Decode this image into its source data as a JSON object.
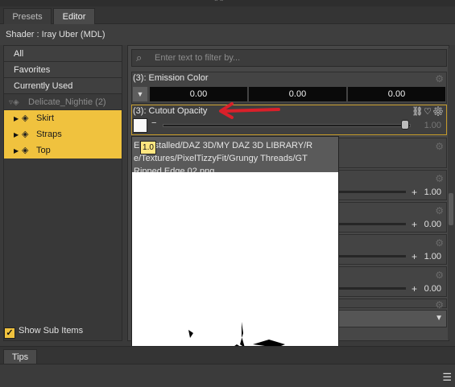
{
  "tabs": [
    {
      "label": "Presets"
    },
    {
      "label": "Editor"
    }
  ],
  "shader_label": "Shader :  Iray Uber (MDL)",
  "left": {
    "items": [
      "All",
      "Favorites",
      "Currently Used"
    ],
    "group": "Delicate_Nightie (2)",
    "surfaces": [
      "Skirt",
      "Straps",
      "Top"
    ],
    "show_sub_items": "Show Sub Items"
  },
  "filter": {
    "placeholder": "Enter text to filter by..."
  },
  "emission": {
    "label": "(3): Emission Color",
    "values": [
      "0.00",
      "0.00",
      "0.00"
    ]
  },
  "cutout": {
    "label": "(3): Cutout Opacity",
    "value": "1.00",
    "level": 1.0
  },
  "rows": [
    {
      "value": "1.00"
    },
    {
      "value": "0.00"
    },
    {
      "value": "1.00"
    },
    {
      "value": "0.00"
    }
  ],
  "popup": {
    "text": "E     : Installed/DAZ 3D/MY DAZ 3D LIBRARY/R       e/Textures/PixelTizzyFit/Grungy Threads/GT Ripped Edge 02.png",
    "badge": "1.0"
  },
  "bottom_tab": "Tips",
  "colors": {
    "accent": "#f0c23e",
    "arrow": "#d9202a"
  }
}
